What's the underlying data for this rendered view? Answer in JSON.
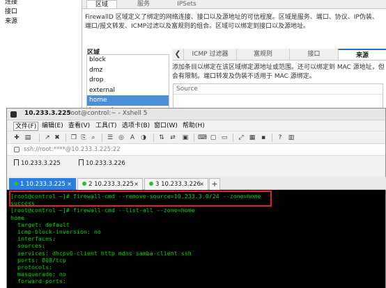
{
  "firewall": {
    "left_pane": {
      "items": [
        "连接",
        "接口",
        "来源"
      ]
    },
    "top_tabs": [
      "区域",
      "服务",
      "IPSets"
    ],
    "description": "FirewallD 区域定义了绑定的网络连接、接口以及源地址的可信程度。区域是服务、端口、协议、IP伪装、端口/报文转发、ICMP过滤以及富规则的组合。区域可以绑定到接口以及源地址。",
    "zone_label": "区域",
    "zones": [
      "block",
      "dmz",
      "drop",
      "external",
      "home",
      "internal"
    ],
    "selected_zone": "home",
    "sub_tabs": [
      "ICMP 过滤器",
      "富规则",
      "接口",
      "来源"
    ],
    "active_sub_tab": "来源",
    "source_description": "添加条目以绑定在该区域绑定源地址或范围。还可以绑定到 MAC 源地址，但会有限制。端口转发及伪装不适用于 MAC 源绑定。",
    "source_table_header": "Source"
  },
  "xshell": {
    "title_ip": "10.233.3.225",
    "title_rest": "root@control:~ - Xshell 5",
    "menu": [
      "文件(F)",
      "编辑(E)",
      "查看(V)",
      "工具(T)",
      "选项卡(B)",
      "窗口(W)",
      "帮助(H)"
    ],
    "active_menu": "文件(F)",
    "address": "ssh://root:****@10.233.3.225:22",
    "quick_links": [
      "10.233.3.225",
      "10.233.3.226"
    ],
    "session_tabs": [
      {
        "num": "1",
        "label": "10.233.3.225"
      },
      {
        "num": "2",
        "label": "10.233.3.225"
      },
      {
        "num": "3",
        "label": "10.233.3.226"
      }
    ],
    "active_session": "1 10.233.3.225",
    "add_tab_label": "+",
    "close_label": "×"
  },
  "terminal": {
    "lines": [
      "[root@control ~]# firewall-cmd --remove-source=10.233.3.0/24 --zone=home",
      "success",
      "[root@control ~]# firewall-cmd --list-all --zone=home",
      "home",
      "  target: default",
      "  icmp-block-inversion: no",
      "  interfaces:",
      "  sources:",
      "  services: dhcpv6-client http mdns samba-client ssh",
      "  ports: 808/tcp",
      "  protocols:",
      "  masquerade: no",
      "  forward-ports:"
    ],
    "highlight_color": "#e4202a",
    "text_color": "#00dd00"
  }
}
